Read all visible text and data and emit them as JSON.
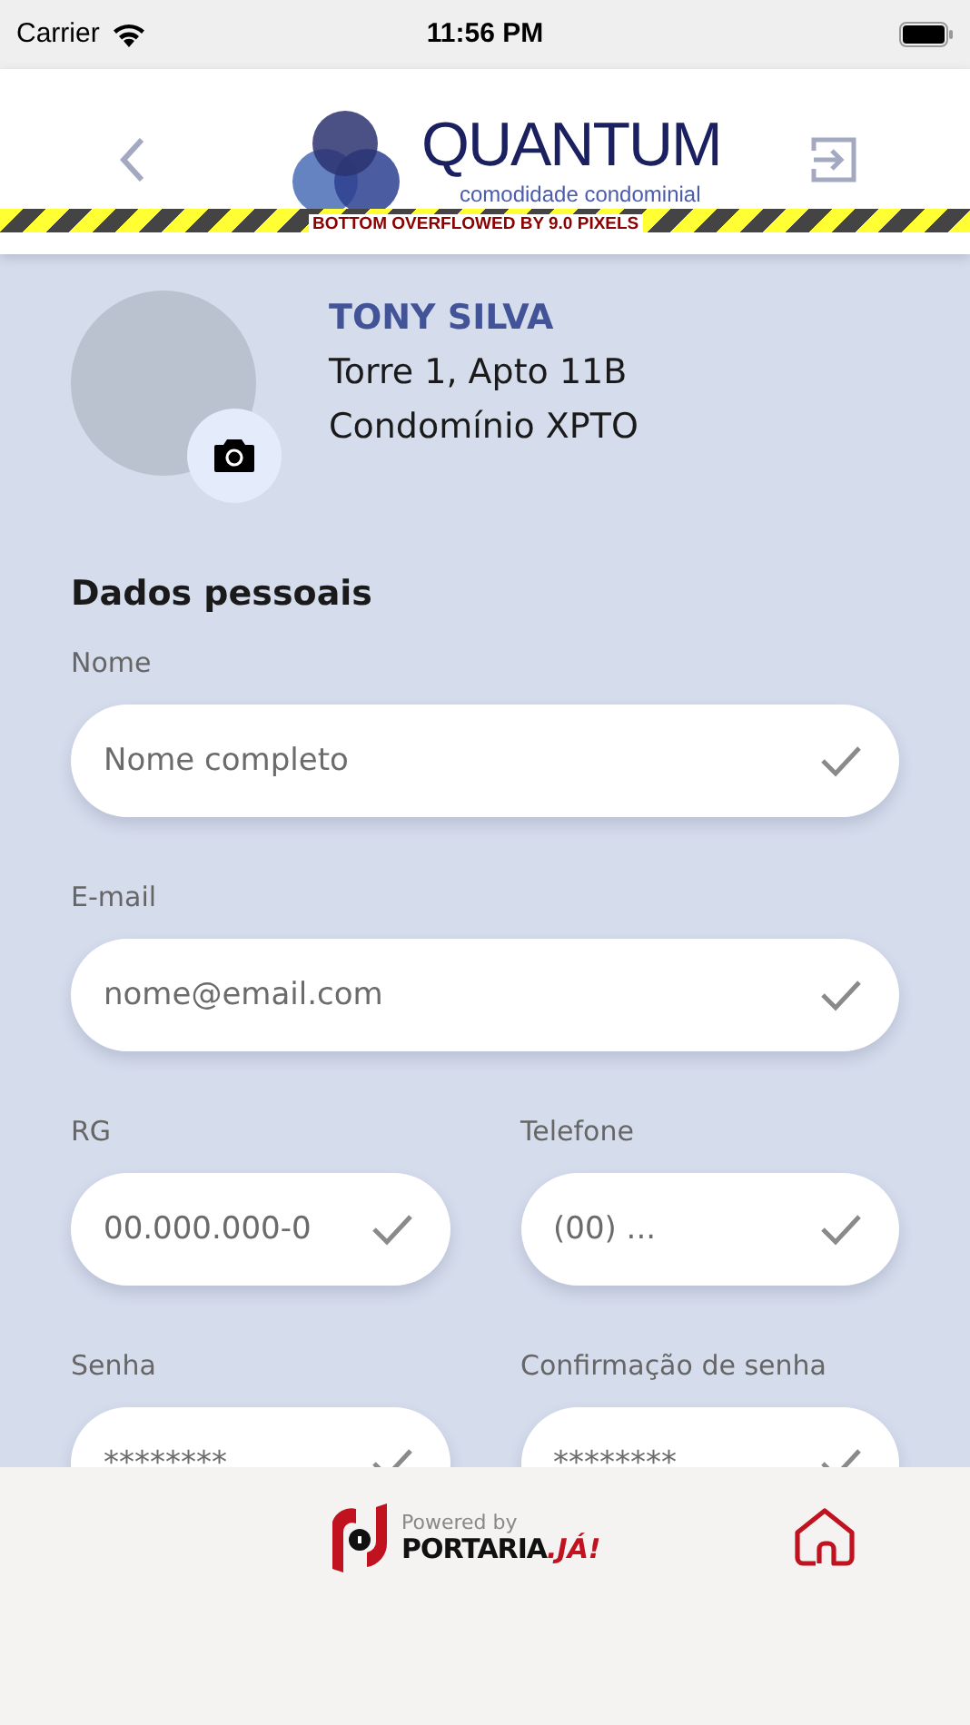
{
  "status_bar": {
    "carrier": "Carrier",
    "time": "11:56 PM"
  },
  "header": {
    "logo_title": "QUANTUM",
    "logo_tagline": "comodidade condominial",
    "overflow_banner": "BOTTOM OVERFLOWED BY 9.0 PIXELS"
  },
  "profile": {
    "name": "TONY SILVA",
    "unit": "Torre 1, Apto 11B",
    "condo": "Condomínio XPTO"
  },
  "section_title": "Dados pessoais",
  "fields": [
    {
      "label": "Nome",
      "placeholder": "Nome completo"
    },
    {
      "label": "E-mail",
      "placeholder": "nome@email.com"
    },
    {
      "label": "RG",
      "placeholder": "00.000.000-0"
    },
    {
      "label": "Telefone",
      "placeholder": "(00) ..."
    },
    {
      "label": "Senha",
      "placeholder": "********"
    },
    {
      "label": "Confirmação de senha",
      "placeholder": "********"
    }
  ],
  "footer": {
    "powered_by": "Powered by",
    "brand": "PORTARIA",
    "brand_suffix": ".JÁ!"
  }
}
